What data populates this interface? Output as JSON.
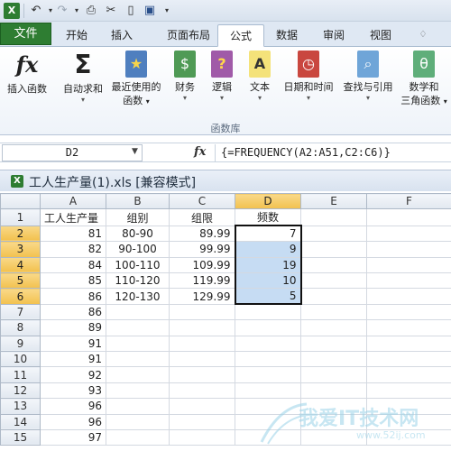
{
  "formula_bar": {
    "name_box": "D2",
    "fx_label": "fx",
    "formula": "{=FREQUENCY(A2:A51,C2:C6)}"
  },
  "tabs": [
    {
      "label": "文件"
    },
    {
      "label": "开始"
    },
    {
      "label": "插入"
    },
    {
      "label": "页面布局"
    },
    {
      "label": "公式"
    },
    {
      "label": "数据"
    },
    {
      "label": "审阅"
    },
    {
      "label": "视图"
    }
  ],
  "ribbon": {
    "buttons": [
      {
        "label": "插入函数",
        "icon": "fx-icon",
        "glyph": "fx"
      },
      {
        "label": "自动求和",
        "icon": "sigma-icon",
        "glyph": "Σ"
      },
      {
        "label": "最近使用的",
        "label2": "函数",
        "icon": "star-book-icon",
        "glyph": "★"
      },
      {
        "label": "财务",
        "icon": "finance-book-icon",
        "glyph": "$"
      },
      {
        "label": "逻辑",
        "icon": "logic-book-icon",
        "glyph": "?"
      },
      {
        "label": "文本",
        "icon": "text-book-icon",
        "glyph": "A"
      },
      {
        "label": "日期和时间",
        "icon": "datetime-book-icon",
        "glyph": "◷"
      },
      {
        "label": "查找与引用",
        "icon": "lookup-book-icon",
        "glyph": "⌕"
      },
      {
        "label": "数学和",
        "label2": "三角函数",
        "icon": "math-book-icon",
        "glyph": "θ"
      }
    ],
    "group_label": "函数库"
  },
  "workbook": {
    "title": "工人生产量(1).xls  [兼容模式]"
  },
  "sheet": {
    "columns": [
      "A",
      "B",
      "C",
      "D",
      "E",
      "F"
    ],
    "rows": [
      {
        "n": "1",
        "a": "工人生产量",
        "b": "组别",
        "c": "组限",
        "d": "频数"
      },
      {
        "n": "2",
        "a": "81",
        "b": "80-90",
        "c": "89.99",
        "d": "7"
      },
      {
        "n": "3",
        "a": "82",
        "b": "90-100",
        "c": "99.99",
        "d": "9"
      },
      {
        "n": "4",
        "a": "84",
        "b": "100-110",
        "c": "109.99",
        "d": "19"
      },
      {
        "n": "5",
        "a": "85",
        "b": "110-120",
        "c": "119.99",
        "d": "10"
      },
      {
        "n": "6",
        "a": "86",
        "b": "120-130",
        "c": "129.99",
        "d": "5"
      },
      {
        "n": "7",
        "a": "86",
        "b": "",
        "c": "",
        "d": ""
      },
      {
        "n": "8",
        "a": "89",
        "b": "",
        "c": "",
        "d": ""
      },
      {
        "n": "9",
        "a": "91",
        "b": "",
        "c": "",
        "d": ""
      },
      {
        "n": "10",
        "a": "91",
        "b": "",
        "c": "",
        "d": ""
      },
      {
        "n": "11",
        "a": "92",
        "b": "",
        "c": "",
        "d": ""
      },
      {
        "n": "12",
        "a": "93",
        "b": "",
        "c": "",
        "d": ""
      },
      {
        "n": "13",
        "a": "96",
        "b": "",
        "c": "",
        "d": ""
      },
      {
        "n": "14",
        "a": "96",
        "b": "",
        "c": "",
        "d": ""
      },
      {
        "n": "15",
        "a": "97",
        "b": "",
        "c": "",
        "d": ""
      }
    ]
  },
  "watermark": {
    "text": "我爱IT技术网",
    "url": "www.52ij.com"
  },
  "colors": {
    "file_tab": "#2e7d32",
    "selection": "#c6dcf3",
    "header_selected": "#f2c14e"
  }
}
